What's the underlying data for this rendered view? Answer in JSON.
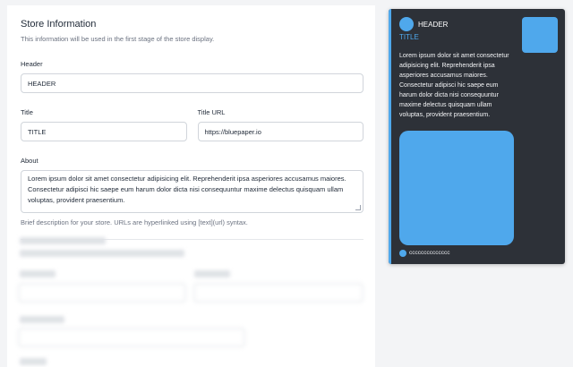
{
  "form": {
    "title": "Store Information",
    "subtitle": "This information will be used in the first stage of the store display.",
    "header_label": "Header",
    "header_value": "HEADER",
    "title_label": "Title",
    "title_value": "TITLE",
    "title_url_label": "Title URL",
    "title_url_value": "https://bluepaper.io",
    "about_label": "About",
    "about_value": "Lorem ipsum dolor sit amet consectetur adipisicing elit. Reprehenderit ipsa asperiores accusamus maiores. Consectetur adipisci hic saepe eum harum dolor dicta nisi consequuntur maxime delectus quisquam ullam voluptas, provident praesentium.",
    "about_help": "Brief description for your store. URLs are hyperlinked using [text](url) syntax."
  },
  "preview": {
    "header": "HEADER",
    "title": "TITLE",
    "text": "Lorem ipsum dolor sit amet consectetur adipisicing elit. Reprehenderit ipsa asperiores accusamus maiores. Consectetur adipisci hic saepe eum harum dolor dicta nisi consequuntur maxime delectus quisquam ullam voluptas, provident praesentium.",
    "footer": "cccccccccccccc",
    "accent_color": "#4fa8ec",
    "card_bg": "#2d3138"
  }
}
